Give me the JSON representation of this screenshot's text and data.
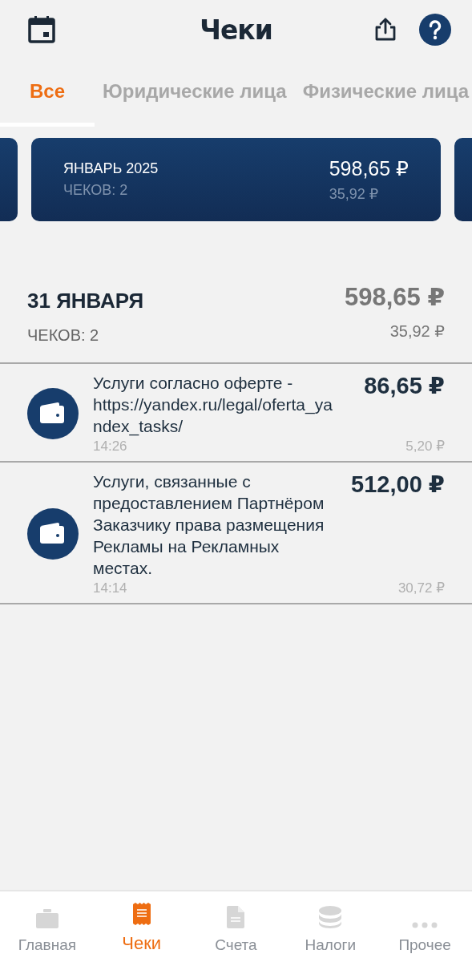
{
  "header": {
    "title": "Чеки"
  },
  "tabs": [
    {
      "label": "Все",
      "selected": true
    },
    {
      "label": "Юридические лица",
      "selected": false
    },
    {
      "label": "Физические лица",
      "selected": false
    }
  ],
  "month_card": {
    "title": "ЯНВАРЬ 2025",
    "count": "ЧЕКОВ: 2",
    "total": "598,65 ₽",
    "tax": "35,92 ₽"
  },
  "day": {
    "date": "31 ЯНВАРЯ",
    "count": "ЧЕКОВ: 2",
    "total": "598,65 ₽",
    "tax": "35,92 ₽"
  },
  "receipts": [
    {
      "description": "Услуги согласно оферте - https://yandex.ru/legal/oferta_yandex_tasks/",
      "amount": "86,65 ₽",
      "time": "14:26",
      "tax": "5,20 ₽"
    },
    {
      "description": "Услуги, связанные с предоставлением Партнёром Заказчику права размещения Рекламы на Рекламных местах.",
      "amount": "512,00 ₽",
      "time": "14:14",
      "tax": "30,72 ₽"
    }
  ],
  "bottom_nav": [
    {
      "kind": "home",
      "label": "Главная",
      "selected": false
    },
    {
      "kind": "receipts",
      "label": "Чеки",
      "selected": true
    },
    {
      "kind": "invoices",
      "label": "Счета",
      "selected": false
    },
    {
      "kind": "taxes",
      "label": "Налоги",
      "selected": false
    },
    {
      "kind": "more",
      "label": "Прочее",
      "selected": false
    }
  ]
}
